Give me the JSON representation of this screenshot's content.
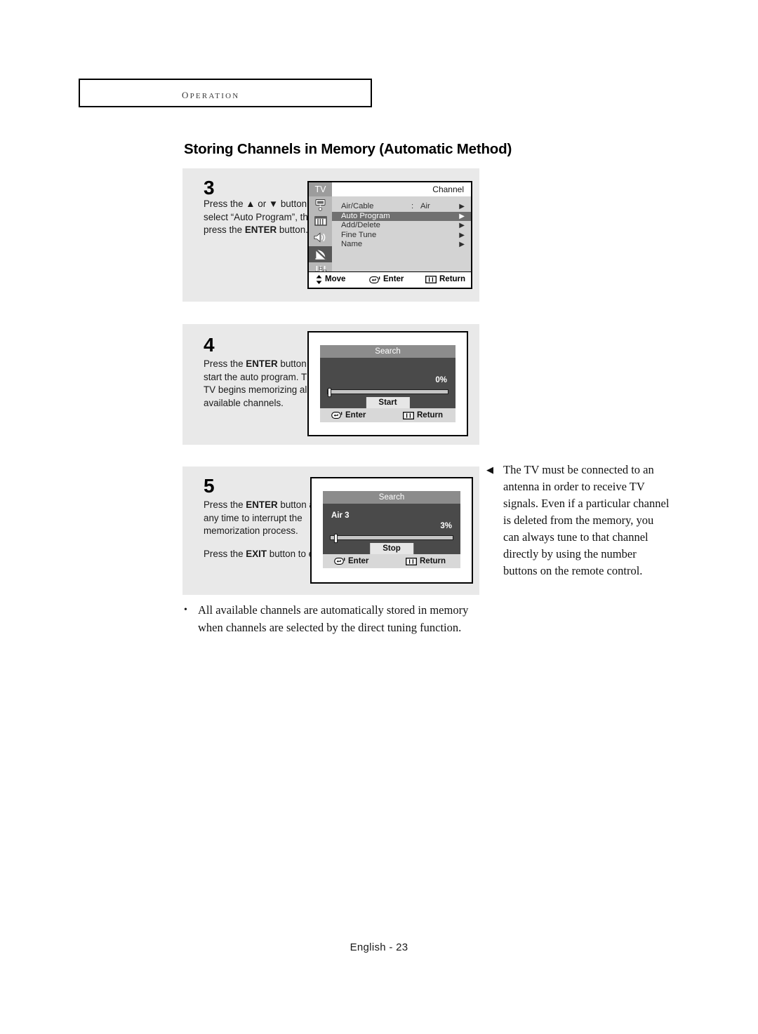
{
  "header": {
    "section_label": "Operation"
  },
  "title": "Storing Channels in Memory (Automatic Method)",
  "steps": [
    {
      "number": "3",
      "text_html": "Press the ▲ or ▼ button to select “Auto Program”, then press the <b>ENTER</b> button."
    },
    {
      "number": "4",
      "text_html": "Press the <b>ENTER</b> button to start the auto program. The TV begins memorizing all available channels."
    },
    {
      "number": "5",
      "text_html": "Press the <b>ENTER</b> button at any time to interrupt the memorization process.<span class=\"gap\"></span>Press the <b>EXIT</b> button to exit."
    }
  ],
  "channel_menu": {
    "tv_tab": "TV",
    "menu_title": "Channel",
    "sidebar_icons": [
      "input-source-icon",
      "picture-icon",
      "sound-icon",
      "channel-dish-icon",
      "setup-sliders-icon"
    ],
    "rows": [
      {
        "label": "Air/Cable",
        "colon": ":",
        "value": "Air",
        "arrow": "▶",
        "selected": false
      },
      {
        "label": "Auto Program",
        "colon": "",
        "value": "",
        "arrow": "▶",
        "selected": true
      },
      {
        "label": "Add/Delete",
        "colon": "",
        "value": "",
        "arrow": "▶",
        "selected": false
      },
      {
        "label": "Fine Tune",
        "colon": "",
        "value": "",
        "arrow": "▶",
        "selected": false
      },
      {
        "label": "Name",
        "colon": "",
        "value": "",
        "arrow": "▶",
        "selected": false
      }
    ],
    "hints": {
      "move": "Move",
      "enter": "Enter",
      "return": "Return"
    }
  },
  "search_dialog_4": {
    "title": "Search",
    "channel": "",
    "percent": "0%",
    "progress_value": 0,
    "button_label": "Start",
    "hints": {
      "enter": "Enter",
      "return": "Return"
    }
  },
  "search_dialog_5": {
    "title": "Search",
    "channel": "Air 3",
    "percent": "3%",
    "progress_value": 3,
    "button_label": "Stop",
    "hints": {
      "enter": "Enter",
      "return": "Return"
    }
  },
  "side_note": {
    "arrow": "◀",
    "text": "The TV must be connected to an antenna in order to receive TV signals. Even if a particular channel is deleted from the memory, you can always tune to that channel directly by using the number buttons on the remote control."
  },
  "bottom_note": {
    "bullet": "•",
    "text": "All available channels are automatically stored in memory when channels are selected by the direct tuning function."
  },
  "footer": "English - 23",
  "colors": {
    "panel_bg": "#e9e9e9",
    "osd_menu_body": "#d3d3d3",
    "osd_sidebar": "#b8b8b8",
    "osd_selected_row": "#707070",
    "osd_search_title": "#8c8c8c",
    "osd_search_main": "#4a4a4a"
  }
}
